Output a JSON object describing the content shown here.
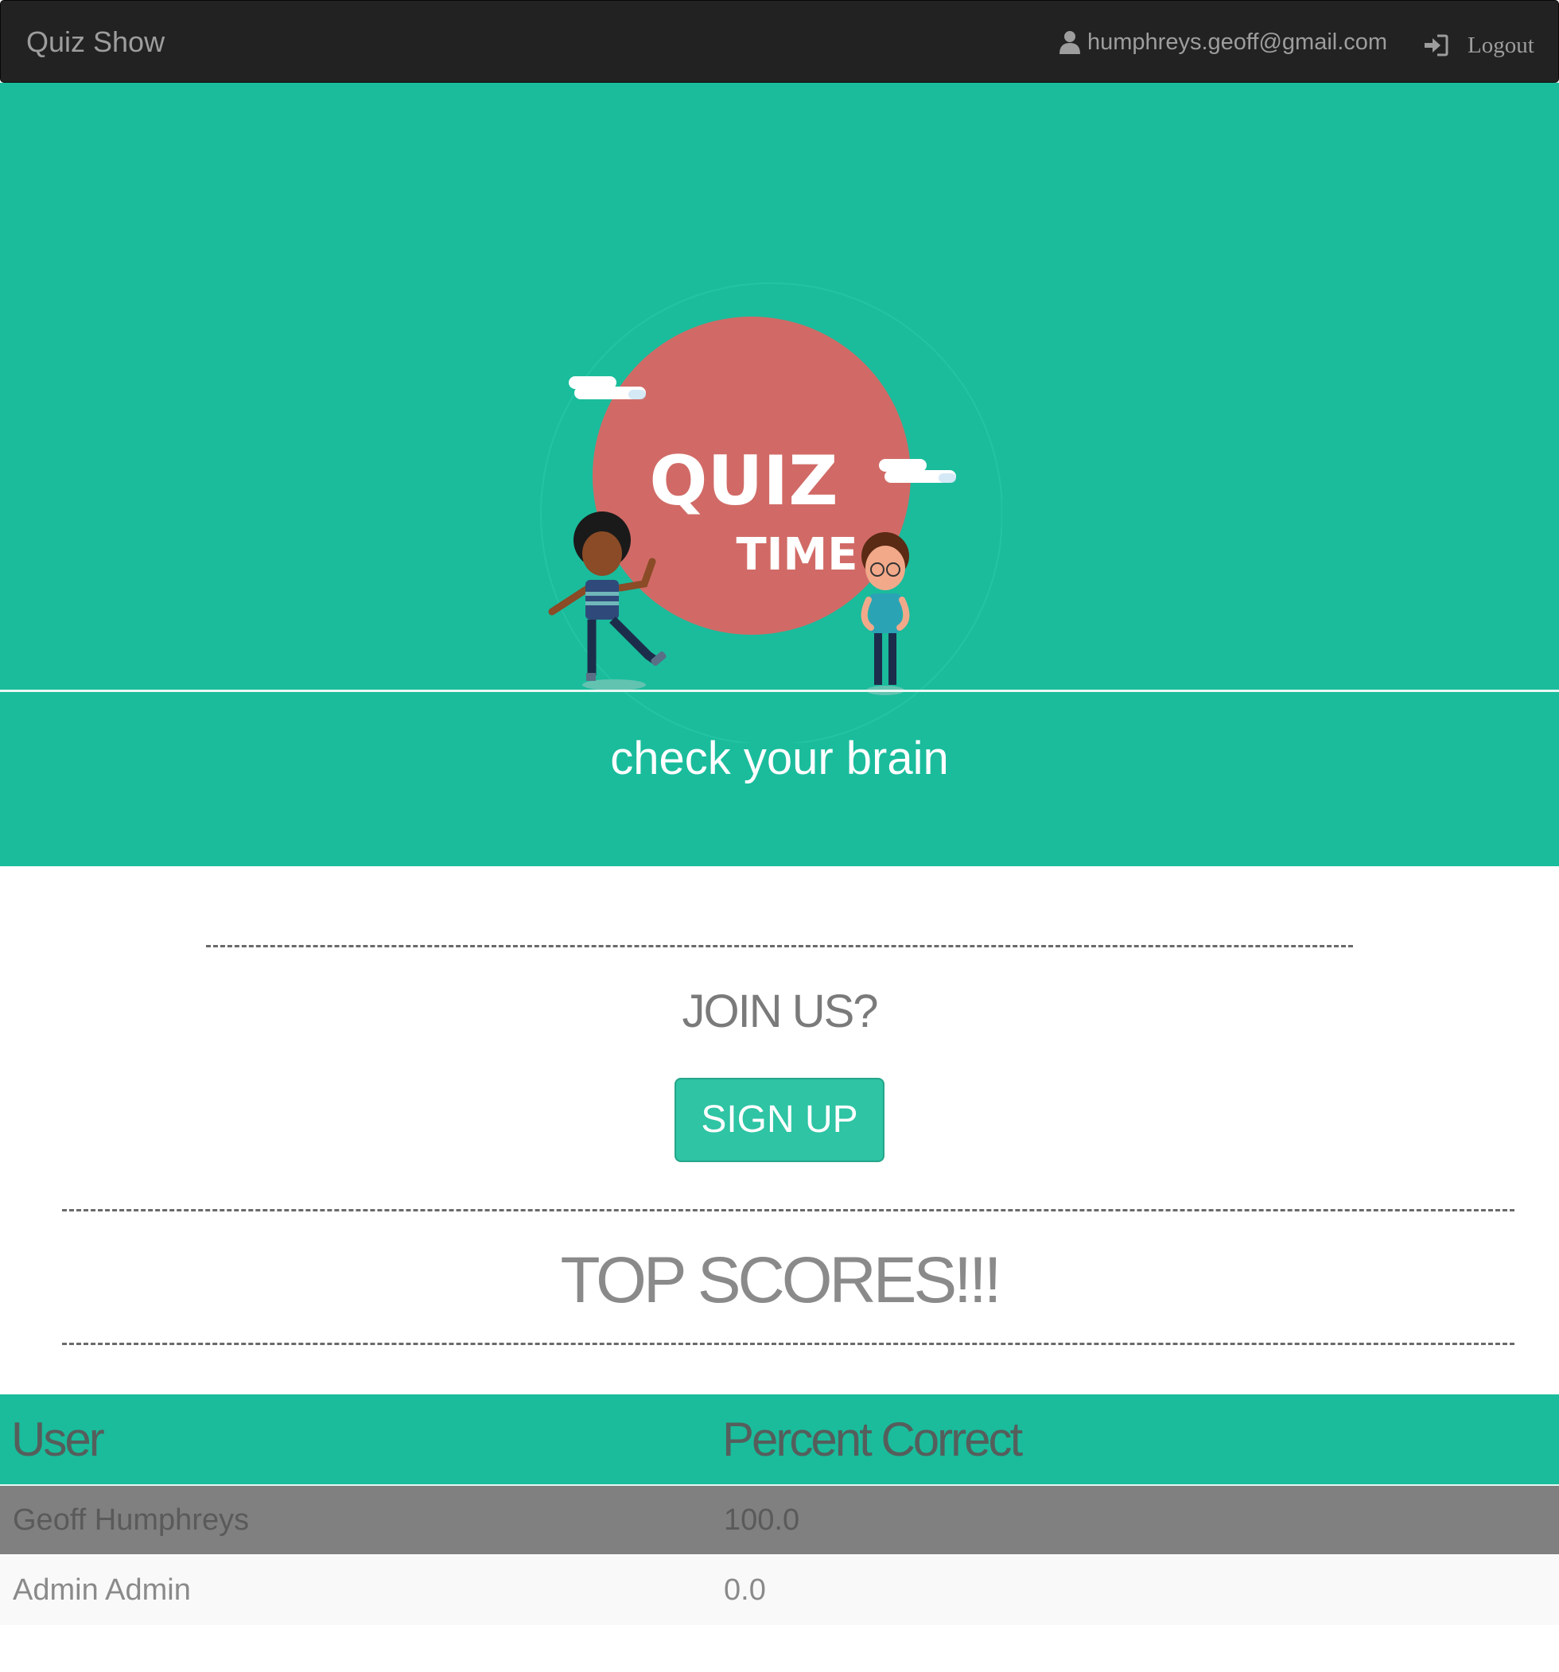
{
  "navbar": {
    "brand": "Quiz Show",
    "user_email": "humphreys.geoff@gmail.com",
    "logout_label": "Logout"
  },
  "hero": {
    "logo_line1": "QUIZ",
    "logo_line2": "TIME",
    "tagline": "check your brain"
  },
  "join": {
    "title": "JOIN US?",
    "signup_label": "SIGN UP"
  },
  "scores": {
    "title": "TOP SCORES!!!",
    "columns": [
      "User",
      "Percent Correct"
    ],
    "rows": [
      {
        "user": "Geoff Humphreys",
        "percent": "100.0"
      },
      {
        "user": "Admin Admin",
        "percent": "0.0"
      }
    ]
  },
  "colors": {
    "teal": "#1abc9c",
    "navbar": "#222222",
    "circle": "#d16a66"
  }
}
